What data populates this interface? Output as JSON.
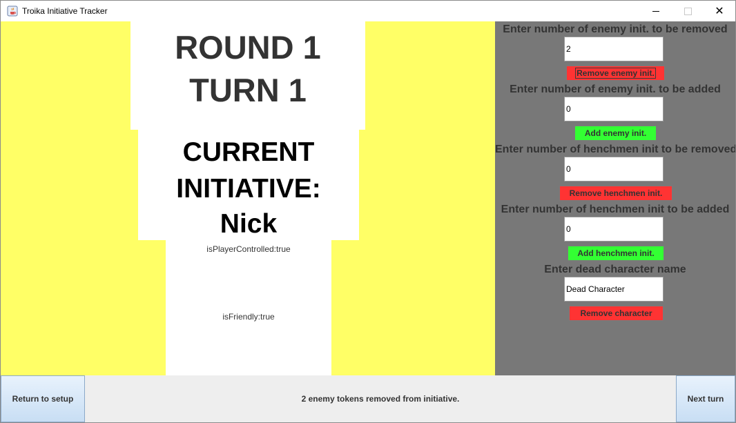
{
  "window": {
    "title": "Troika Initiative Tracker",
    "icon": "java-cup-icon",
    "close_glyph": "✕"
  },
  "colors": {
    "background_yellow": "#ffff66",
    "panel_white": "#ffffff",
    "right_panel_gray": "#787878",
    "button_red": "#ff3333",
    "button_green": "#33ff33"
  },
  "round": {
    "round_label": "ROUND 1",
    "turn_label": "TURN 1"
  },
  "current": {
    "label_line1": "CURRENT",
    "label_line2": "INITIATIVE:",
    "name": "Nick",
    "player_controlled": "isPlayerControlled:true",
    "friendly": "isFriendly:true"
  },
  "controls": {
    "remove_enemy": {
      "label": "Enter number of enemy init. to be removed",
      "value": "2",
      "button": "Remove enemy init."
    },
    "add_enemy": {
      "label": "Enter number of enemy init. to be added",
      "value": "0",
      "button": "Add enemy init."
    },
    "remove_henchmen": {
      "label": "Enter number of henchmen init to be removed",
      "value": "0",
      "button": "Remove henchmen init."
    },
    "add_henchmen": {
      "label": "Enter number of henchmen init to be added",
      "value": "0",
      "button": "Add henchmen init."
    },
    "dead_character": {
      "label": "Enter dead character name",
      "value": "Dead Character",
      "button": "Remove character"
    }
  },
  "bottom": {
    "return_button": "Return to setup",
    "status": "2 enemy tokens removed from initiative.",
    "next_button": "Next turn"
  }
}
